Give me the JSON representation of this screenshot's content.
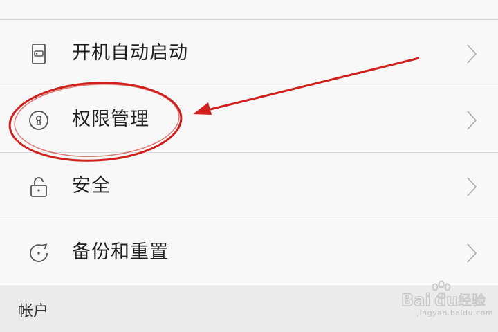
{
  "settings": {
    "items": [
      {
        "label": "开机自动启动",
        "icon": "phone-card-icon"
      },
      {
        "label": "权限管理",
        "icon": "keyhole-icon"
      },
      {
        "label": "安全",
        "icon": "lock-open-icon"
      },
      {
        "label": "备份和重置",
        "icon": "refresh-icon"
      }
    ],
    "section_header": "帐户"
  },
  "annotation": {
    "color": "#d0201c"
  },
  "watermark": {
    "brand": "Bai du 经验",
    "url": "jingyan.baidu.com"
  }
}
